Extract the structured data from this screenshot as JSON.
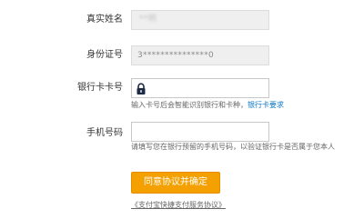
{
  "form": {
    "name": {
      "label": "真实姓名",
      "value": "**明"
    },
    "id_number": {
      "label": "身份证号",
      "value": "3***************0"
    },
    "bank_card": {
      "label": "银行卡卡号",
      "value": "",
      "icon": "lock-icon",
      "hint": "输入卡号后会智能识别银行和卡种，",
      "hint_link": "银行卡要求"
    },
    "phone": {
      "label": "手机号码",
      "value": "",
      "hint": "请填写您在银行预留的手机号码，以验证银行卡是否属于您本人"
    },
    "submit_label": "同意协议并确定",
    "agreement_link": "《支付宝快捷支付服务协议》"
  },
  "colors": {
    "accent": "#f3a000",
    "link": "#0a77c4",
    "readonly_bg": "#efefef",
    "border": "#c8c8c8"
  }
}
